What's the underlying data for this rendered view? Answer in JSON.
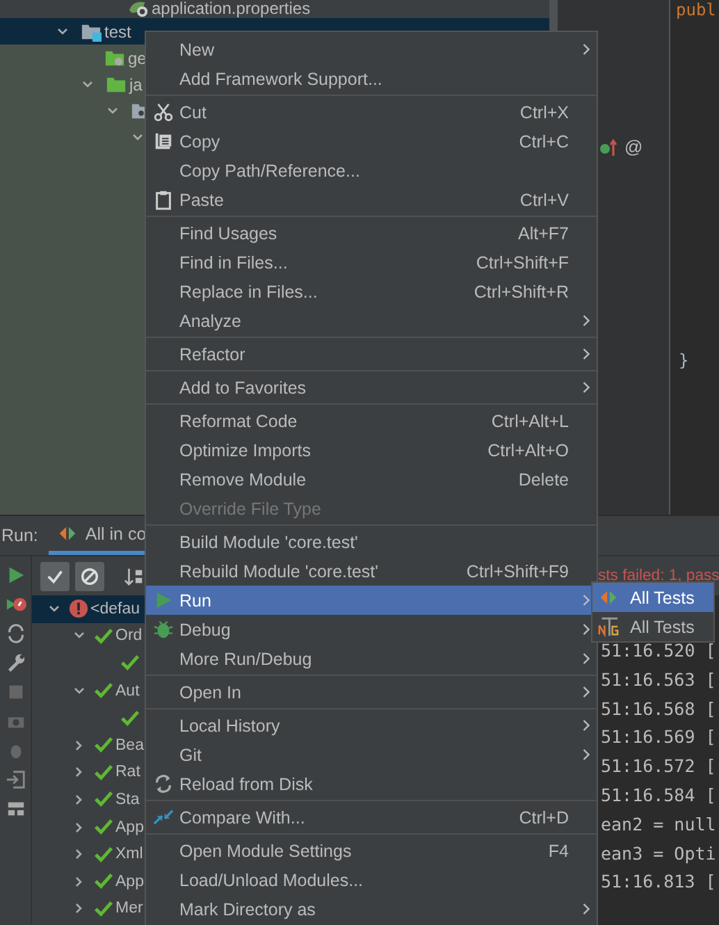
{
  "project_tree": {
    "items": [
      {
        "kind": "properties-file",
        "label": "application.properties",
        "selected": false
      },
      {
        "kind": "test-folder",
        "label": "test",
        "expanded": true,
        "selected": true,
        "children": [
          {
            "kind": "resources-folder",
            "label": "ge",
            "selected": false
          },
          {
            "kind": "source-folder",
            "label": "ja",
            "expanded": true,
            "selected": false,
            "children": [
              {
                "kind": "package",
                "expanded": true,
                "selected": false,
                "children": [
                  {
                    "expanded": true,
                    "selected": false
                  }
                ]
              }
            ]
          }
        ]
      }
    ]
  },
  "editor": {
    "code_top": "publ",
    "closing_brace": "}",
    "gutter_symbol": "@"
  },
  "context_menu": {
    "items": [
      {
        "kind": "item",
        "label": "New",
        "submenu": true,
        "disabled": false,
        "selected": false
      },
      {
        "kind": "item",
        "label": "Add Framework Support...",
        "submenu": false,
        "disabled": false,
        "selected": false
      },
      {
        "kind": "separator"
      },
      {
        "kind": "cut",
        "label": "Cut",
        "shortcut": "Ctrl+X",
        "submenu": false,
        "disabled": false,
        "selected": false
      },
      {
        "kind": "copy",
        "label": "Copy",
        "shortcut": "Ctrl+C",
        "submenu": false,
        "disabled": false,
        "selected": false
      },
      {
        "kind": "item",
        "label": "Copy Path/Reference...",
        "submenu": false,
        "disabled": false,
        "selected": false
      },
      {
        "kind": "paste",
        "label": "Paste",
        "shortcut": "Ctrl+V",
        "submenu": false,
        "disabled": false,
        "selected": false
      },
      {
        "kind": "separator"
      },
      {
        "kind": "item",
        "label": "Find Usages",
        "shortcut": "Alt+F7",
        "submenu": false,
        "disabled": false,
        "selected": false
      },
      {
        "kind": "item",
        "label": "Find in Files...",
        "shortcut": "Ctrl+Shift+F",
        "submenu": false,
        "disabled": false,
        "selected": false
      },
      {
        "kind": "item",
        "label": "Replace in Files...",
        "shortcut": "Ctrl+Shift+R",
        "submenu": false,
        "disabled": false,
        "selected": false
      },
      {
        "kind": "item",
        "label": "Analyze",
        "submenu": true,
        "disabled": false,
        "selected": false
      },
      {
        "kind": "separator"
      },
      {
        "kind": "item",
        "label": "Refactor",
        "submenu": true,
        "disabled": false,
        "selected": false
      },
      {
        "kind": "separator"
      },
      {
        "kind": "item",
        "label": "Add to Favorites",
        "submenu": true,
        "disabled": false,
        "selected": false
      },
      {
        "kind": "separator"
      },
      {
        "kind": "item",
        "label": "Reformat Code",
        "shortcut": "Ctrl+Alt+L",
        "submenu": false,
        "disabled": false,
        "selected": false
      },
      {
        "kind": "item",
        "label": "Optimize Imports",
        "shortcut": "Ctrl+Alt+O",
        "submenu": false,
        "disabled": false,
        "selected": false
      },
      {
        "kind": "item",
        "label": "Remove Module",
        "shortcut": "Delete",
        "submenu": false,
        "disabled": false,
        "selected": false
      },
      {
        "kind": "item",
        "label": "Override File Type",
        "submenu": false,
        "disabled": true,
        "selected": false
      },
      {
        "kind": "separator"
      },
      {
        "kind": "item",
        "label": "Build Module 'core.test'",
        "submenu": false,
        "disabled": false,
        "selected": false
      },
      {
        "kind": "item",
        "label": "Rebuild Module 'core.test'",
        "shortcut": "Ctrl+Shift+F9",
        "submenu": false,
        "disabled": false,
        "selected": false
      },
      {
        "kind": "run",
        "label": "Run",
        "submenu": true,
        "disabled": false,
        "selected": true
      },
      {
        "kind": "debug",
        "label": "Debug",
        "submenu": true,
        "disabled": false,
        "selected": false
      },
      {
        "kind": "item",
        "label": "More Run/Debug",
        "submenu": true,
        "disabled": false,
        "selected": false
      },
      {
        "kind": "separator"
      },
      {
        "kind": "item",
        "label": "Open In",
        "submenu": true,
        "disabled": false,
        "selected": false
      },
      {
        "kind": "separator"
      },
      {
        "kind": "item",
        "label": "Local History",
        "submenu": true,
        "disabled": false,
        "selected": false
      },
      {
        "kind": "item",
        "label": "Git",
        "submenu": true,
        "disabled": false,
        "selected": false
      },
      {
        "kind": "reload",
        "label": "Reload from Disk",
        "submenu": false,
        "disabled": false,
        "selected": false
      },
      {
        "kind": "separator"
      },
      {
        "kind": "compare",
        "label": "Compare With...",
        "shortcut": "Ctrl+D",
        "submenu": false,
        "disabled": false,
        "selected": false
      },
      {
        "kind": "separator"
      },
      {
        "kind": "item",
        "label": "Open Module Settings",
        "shortcut": "F4",
        "submenu": false,
        "disabled": false,
        "selected": false
      },
      {
        "kind": "item",
        "label": "Load/Unload Modules...",
        "submenu": false,
        "disabled": false,
        "selected": false
      },
      {
        "kind": "item",
        "label": "Mark Directory as",
        "submenu": true,
        "disabled": false,
        "selected": false
      }
    ]
  },
  "submenu": {
    "items": [
      {
        "kind": "junit",
        "label": "All Tests",
        "selected": true
      },
      {
        "kind": "testng",
        "label": "All Tests",
        "selected": false
      }
    ]
  },
  "run_panel": {
    "label": "Run:",
    "tab": "All in co",
    "summary": "sts failed: 1, pass",
    "tests": [
      {
        "label": "<defau",
        "passed": false,
        "expanded": true,
        "children": [
          {
            "label": "Ord",
            "passed": true,
            "expanded": true,
            "children": [
              {
                "passed": true
              }
            ]
          },
          {
            "label": "Aut",
            "passed": true,
            "expanded": true,
            "children": [
              {
                "passed": true
              }
            ]
          },
          {
            "label": "Bea",
            "passed": true,
            "expanded": false
          },
          {
            "label": "Rat",
            "passed": true,
            "expanded": false
          },
          {
            "label": "Sta",
            "passed": true,
            "expanded": false
          },
          {
            "label": "App",
            "passed": true,
            "expanded": false
          },
          {
            "label": "Xml",
            "passed": true,
            "expanded": false
          },
          {
            "label": "App",
            "passed": true,
            "expanded": false
          },
          {
            "label": "Mer",
            "passed": true,
            "expanded": false
          }
        ]
      }
    ],
    "console": [
      "51:16.520 [",
      "51:16.563 [",
      "51:16.568 [",
      "51:16.569 [",
      "51:16.572 [",
      "51:16.584 [",
      "ean2 = null",
      "ean3 = Opti",
      "51:16.813 ["
    ]
  }
}
